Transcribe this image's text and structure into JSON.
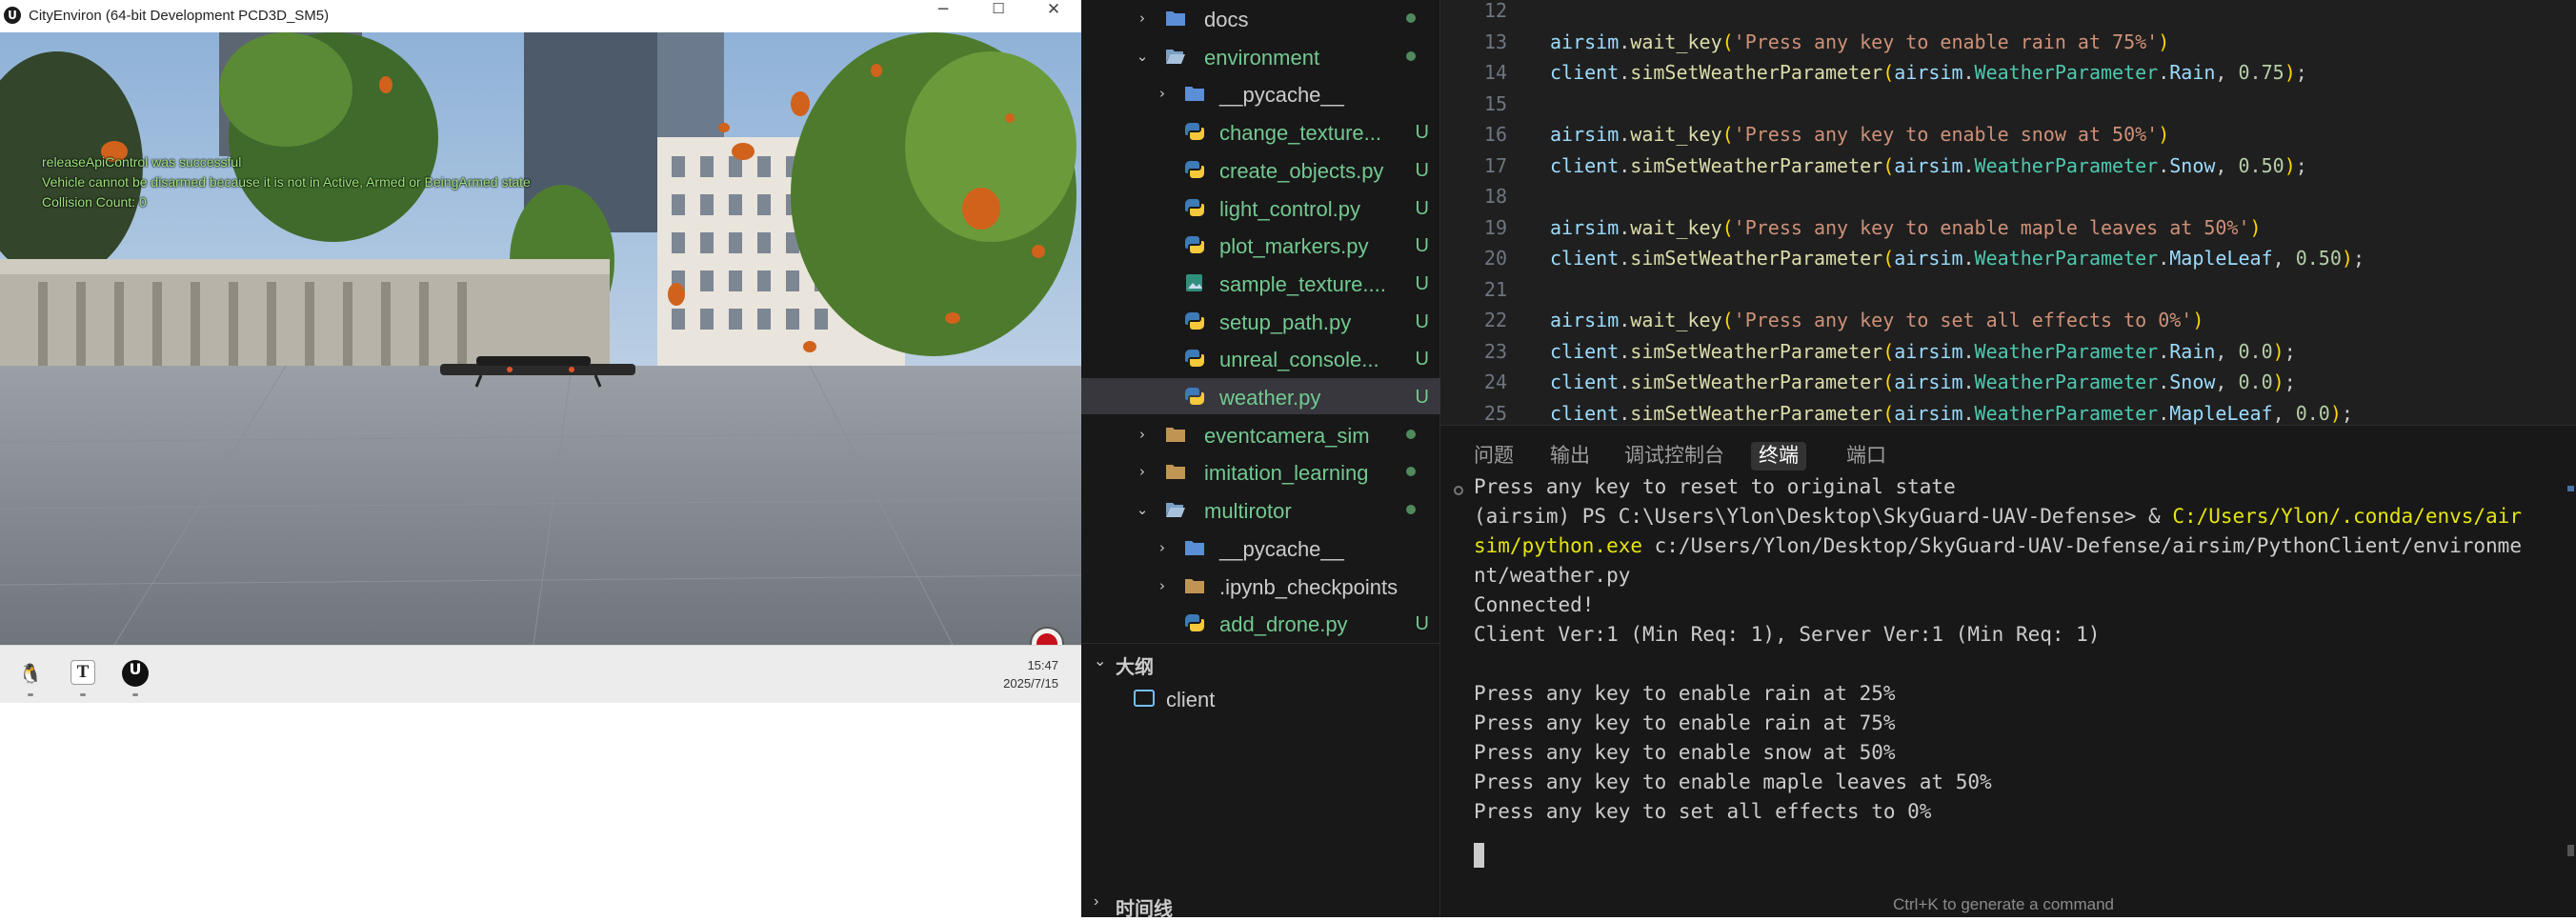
{
  "game": {
    "window_title": "CityEnviron (64-bit Development PCD3D_SM5)",
    "app_icon": "U",
    "controls": {
      "minimize": "─",
      "maximize": "☐",
      "close": "✕"
    },
    "overlay_lines": [
      "releaseApiControl was successful",
      "Vehicle cannot be disarmed because it is not in Active, Armed or BeingArmed state",
      "Collision Count: 0"
    ],
    "record_icon": "record-icon"
  },
  "taskbar": {
    "apps": [
      {
        "name": "penguin-app-icon",
        "glyph": "🐧"
      },
      {
        "name": "typora-icon",
        "glyph": "T"
      },
      {
        "name": "unreal-engine-icon",
        "glyph": "U"
      }
    ],
    "time": "15:47",
    "date": "2025/7/15"
  },
  "explorer": {
    "tree": [
      {
        "label": "docs",
        "chev": "›",
        "type": "folder-doc",
        "mark": "dot",
        "git": false,
        "indent": 1
      },
      {
        "label": "environment",
        "chev": "⌄",
        "type": "folder-open",
        "mark": "dot",
        "git": true,
        "indent": 1
      },
      {
        "label": "__pycache__",
        "chev": "›",
        "type": "folder-py",
        "mark": "",
        "git": false,
        "indent": 2
      },
      {
        "label": "change_texture...",
        "chev": "",
        "type": "py",
        "mark": "U",
        "git": true,
        "indent": 2
      },
      {
        "label": "create_objects.py",
        "chev": "",
        "type": "py",
        "mark": "U",
        "git": true,
        "indent": 2
      },
      {
        "label": "light_control.py",
        "chev": "",
        "type": "py",
        "mark": "U",
        "git": true,
        "indent": 2
      },
      {
        "label": "plot_markers.py",
        "chev": "",
        "type": "py",
        "mark": "U",
        "git": true,
        "indent": 2
      },
      {
        "label": "sample_texture....",
        "chev": "",
        "type": "img",
        "mark": "U",
        "git": true,
        "indent": 2
      },
      {
        "label": "setup_path.py",
        "chev": "",
        "type": "py",
        "mark": "U",
        "git": true,
        "indent": 2
      },
      {
        "label": "unreal_console...",
        "chev": "",
        "type": "py",
        "mark": "U",
        "git": true,
        "indent": 2
      },
      {
        "label": "weather.py",
        "chev": "",
        "type": "py",
        "mark": "U",
        "git": true,
        "indent": 2,
        "selected": true
      },
      {
        "label": "eventcamera_sim",
        "chev": "›",
        "type": "folder",
        "mark": "dot",
        "git": true,
        "indent": 1
      },
      {
        "label": "imitation_learning",
        "chev": "›",
        "type": "folder",
        "mark": "dot",
        "git": true,
        "indent": 1
      },
      {
        "label": "multirotor",
        "chev": "⌄",
        "type": "folder-open",
        "mark": "dot",
        "git": true,
        "indent": 1
      },
      {
        "label": "__pycache__",
        "chev": "›",
        "type": "folder-py",
        "mark": "",
        "git": false,
        "indent": 2
      },
      {
        "label": ".ipynb_checkpoints",
        "chev": "›",
        "type": "folder",
        "mark": "",
        "git": false,
        "indent": 2
      },
      {
        "label": "add_drone.py",
        "chev": "",
        "type": "py",
        "mark": "U",
        "git": true,
        "indent": 2
      }
    ],
    "outline_title": "大纲",
    "outline_chev": "⌄",
    "outline_item": "client",
    "timeline_title": "时间线",
    "timeline_chev": "›"
  },
  "editor": {
    "lines": [
      {
        "n": "12",
        "k": "blank"
      },
      {
        "n": "13",
        "k": "wait",
        "s": "'Press any key to enable rain at 75%'"
      },
      {
        "n": "14",
        "k": "set",
        "p": "Rain",
        "v": "0.75"
      },
      {
        "n": "15",
        "k": "blank"
      },
      {
        "n": "16",
        "k": "wait",
        "s": "'Press any key to enable snow at 50%'"
      },
      {
        "n": "17",
        "k": "set",
        "p": "Snow",
        "v": "0.50"
      },
      {
        "n": "18",
        "k": "blank"
      },
      {
        "n": "19",
        "k": "wait",
        "s": "'Press any key to enable maple leaves at 50%'"
      },
      {
        "n": "20",
        "k": "set",
        "p": "MapleLeaf",
        "v": "0.50"
      },
      {
        "n": "21",
        "k": "blank"
      },
      {
        "n": "22",
        "k": "wait",
        "s": "'Press any key to set all effects to 0%'"
      },
      {
        "n": "23",
        "k": "set",
        "p": "Rain",
        "v": "0.0"
      },
      {
        "n": "24",
        "k": "set",
        "p": "Snow",
        "v": "0.0"
      },
      {
        "n": "25",
        "k": "set",
        "p": "MapleLeaf",
        "v": "0.0"
      }
    ]
  },
  "panel": {
    "tabs": [
      "问题",
      "输出",
      "调试控制台",
      "终端",
      "端口"
    ],
    "active_tab": "终端",
    "terminal": [
      {
        "t": "Press any key to reset to original state"
      },
      {
        "t": "(airsim) PS C:\\Users\\Ylon\\Desktop\\SkyGuard-UAV-Defense> & ",
        "y": "C:/Users/Ylon/.conda/envs/air"
      },
      {
        "y": "sim/python.exe",
        "t": " c:/Users/Ylon/Desktop/SkyGuard-UAV-Defense/airsim/PythonClient/environme"
      },
      {
        "t": "nt/weather.py"
      },
      {
        "t": "Connected!"
      },
      {
        "t": "Client Ver:1 (Min Req: 1), Server Ver:1 (Min Req: 1)"
      },
      {
        "t": ""
      },
      {
        "t": "Press any key to enable rain at 25%"
      },
      {
        "t": "Press any key to enable rain at 75%"
      },
      {
        "t": "Press any key to enable snow at 50%"
      },
      {
        "t": "Press any key to enable maple leaves at 50%"
      },
      {
        "t": "Press any key to set all effects to 0%"
      }
    ],
    "hint": "Ctrl+K to generate a command"
  },
  "colors": {
    "git_untracked": "#73c991",
    "editor_bg": "#1f1f1f",
    "panel_bg": "#181818"
  }
}
